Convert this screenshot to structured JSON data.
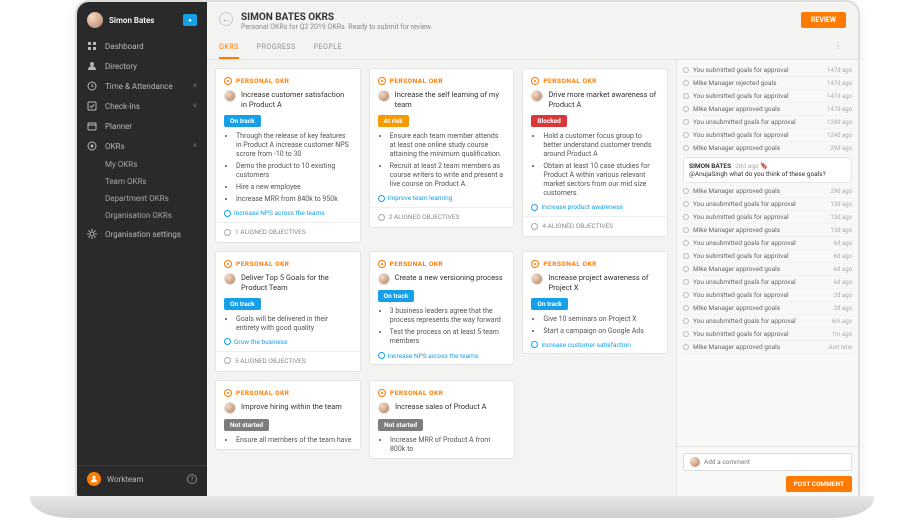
{
  "user": {
    "name": "Simon Bates",
    "notifications": ""
  },
  "sidebar": {
    "items": [
      {
        "label": "Dashboard",
        "icon": "grid"
      },
      {
        "label": "Directory",
        "icon": "people"
      },
      {
        "label": "Time & Attendance",
        "icon": "clock",
        "expandable": true
      },
      {
        "label": "Check-Ins",
        "icon": "check",
        "expandable": true
      },
      {
        "label": "Planner",
        "icon": "planner"
      },
      {
        "label": "OKRs",
        "icon": "target",
        "expanded": true
      },
      {
        "label": "Organisation settings",
        "icon": "gear"
      }
    ],
    "okr_sub": [
      "My OKRs",
      "Team OKRs",
      "Department OKRs",
      "Organisation OKRs"
    ],
    "brand": "Workteam"
  },
  "header": {
    "title": "SIMON BATES OKRS",
    "subtitle": "Personal OKRs for Q2 2019 OKRs. Ready to submit for review.",
    "review": "REVIEW"
  },
  "tabs": [
    "OKRS",
    "PROGRESS",
    "PEOPLE"
  ],
  "cards": [
    [
      {
        "type": "PERSONAL OKR",
        "title": "Increase customer satisfaction in Product A",
        "status": "On track",
        "status_cls": "s-on",
        "bullets": [
          "Through the release of key features in Product A increase customer NPS scrore from -10 to 30",
          "Demo the product to 10 existing customers",
          "Hire a new employee",
          "Increase MRR from 840k to 950k"
        ],
        "link": "Increase NPS across the teams",
        "aligned": "1 ALIGNED OBJECTIVES"
      },
      {
        "type": "PERSONAL OKR",
        "title": "Increase the self learning of my team",
        "status": "At risk",
        "status_cls": "s-risk",
        "bullets": [
          "Ensure each team member attends at least one online study course attaining the minimum qualification.",
          "Recruit at least 2 team members as course writers to write and present a live course on Product A."
        ],
        "link": "Improve team learning",
        "aligned": "2 ALIGNED OBJECTIVES"
      },
      {
        "type": "PERSONAL OKR",
        "title": "Drive more market awareness of Product A",
        "status": "Blocked",
        "status_cls": "s-block",
        "bullets": [
          "Hold a customer focus group to better understand customer trends around Product A",
          "Obtain at least 10 case studies for Product A within various relevant market sectors from our mid size customers."
        ],
        "link": "Increase product awareness",
        "aligned": "4 ALIGNED OBJECTIVES"
      }
    ],
    [
      {
        "type": "PERSONAL OKR",
        "title": "Deliver Top 5 Goals for the Product Team",
        "status": "On track",
        "status_cls": "s-on",
        "bullets": [
          "Goals will be delivered in their entirety with good quality"
        ],
        "link": "Grow the business",
        "aligned": "5 ALIGNED OBJECTIVES"
      },
      {
        "type": "PERSONAL OKR",
        "title": "Create a new versioning process",
        "status": "On track",
        "status_cls": "s-on",
        "bullets": [
          "3 business leaders agree that the process represents the way forward",
          "Test the process on at least 5 team members"
        ],
        "link": "Increase NPS across the teams",
        "aligned": ""
      },
      {
        "type": "PERSONAL OKR",
        "title": "Increase project awareness of Project X",
        "status": "On track",
        "status_cls": "s-on",
        "bullets": [
          "Give 10 seminars on Project X",
          "Start a campaign on Google Ads"
        ],
        "link": "Increase customer satisfaction",
        "aligned": ""
      }
    ],
    [
      {
        "type": "PERSONAL OKR",
        "title": "Improve hiring within the team",
        "status": "Not started",
        "status_cls": "s-not",
        "bullets": [
          "Ensure all members of the team have"
        ],
        "aligned": ""
      },
      {
        "type": "PERSONAL OKR",
        "title": "Increase sales of Product A",
        "status": "Not started",
        "status_cls": "s-not",
        "bullets": [
          "Increase MRR of Product A from 800k to"
        ],
        "aligned": ""
      }
    ]
  ],
  "feed": {
    "items": [
      {
        "text": "You submitted goals for approval",
        "time": "147d ago"
      },
      {
        "text": "Mike Manager rejected goals",
        "time": "147d ago"
      },
      {
        "text": "You submitted goals for approval",
        "time": "147d ago"
      },
      {
        "text": "Mike Manager approved goals",
        "time": "147d ago"
      },
      {
        "text": "You unsubmitted goals for approval",
        "time": "124d ago"
      },
      {
        "text": "You submitted goals for approval",
        "time": "124d ago"
      },
      {
        "text": "Mike Manager approved goals",
        "time": "29d ago"
      }
    ],
    "comment": {
      "user": "SIMON BATES",
      "time": "28d ago",
      "body": "@AnujaSingh what do you think of these goals?"
    },
    "items2": [
      {
        "text": "Mike Manager approved goals",
        "time": "29d ago"
      },
      {
        "text": "You unsubmitted goals for approval",
        "time": "13d ago"
      },
      {
        "text": "You submitted goals for approval",
        "time": "13d ago"
      },
      {
        "text": "Mike Manager approved goals",
        "time": "13d ago"
      },
      {
        "text": "You unsubmitted goals for approval",
        "time": "6d ago"
      },
      {
        "text": "You submitted goals for approval",
        "time": "6d ago"
      },
      {
        "text": "Mike Manager approved goals",
        "time": "6d ago"
      },
      {
        "text": "You unsubmitted goals for approval",
        "time": "6d ago"
      },
      {
        "text": "You submitted goals for approval",
        "time": "2d ago"
      },
      {
        "text": "Mike Manager approved goals",
        "time": "2d ago"
      },
      {
        "text": "You unsubmitted goals for approval",
        "time": "6m ago"
      },
      {
        "text": "You submitted goals for approval",
        "time": "1m ago"
      },
      {
        "text": "Mike Manager approved goals",
        "time": "Just now"
      }
    ],
    "placeholder": "Add a comment",
    "post": "POST COMMENT"
  }
}
